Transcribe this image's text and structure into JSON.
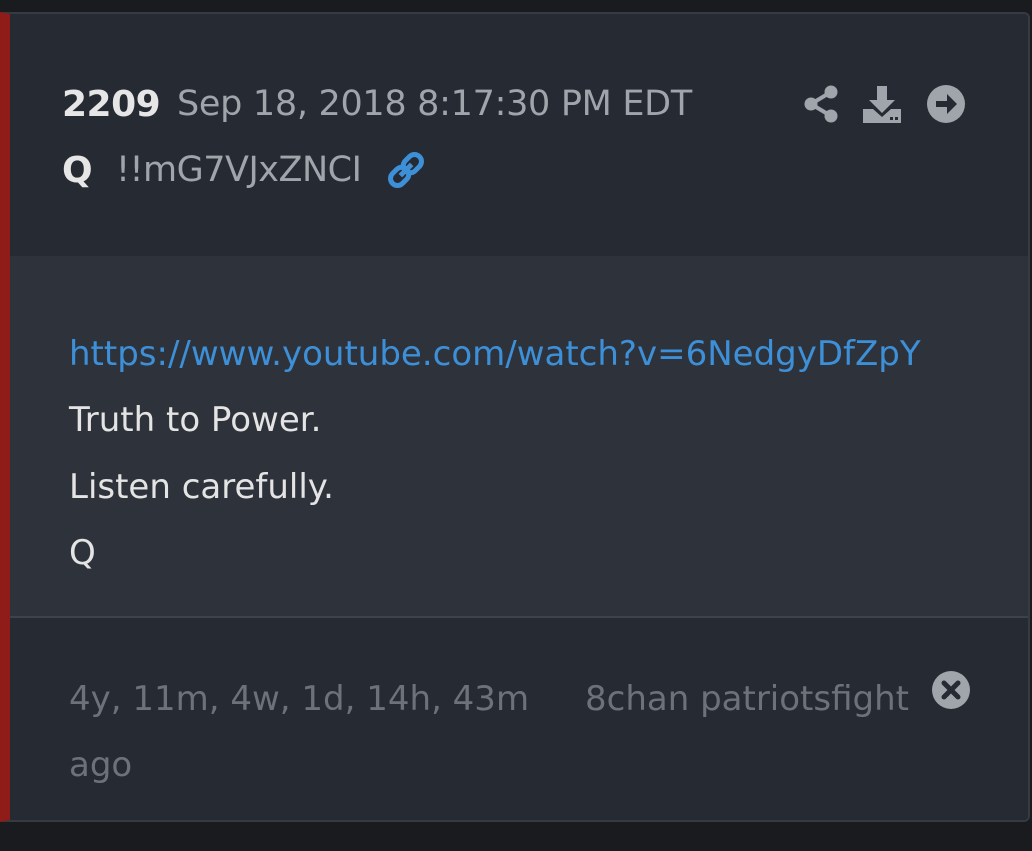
{
  "post": {
    "number": "2209",
    "timestamp": "Sep 18, 2018 8:17:30 PM EDT",
    "author": "Q",
    "tripcode": "!!mG7VJxZNCI"
  },
  "toolbar": {
    "icons": [
      "share-icon",
      "download-icon",
      "arrow-right-circle-icon"
    ],
    "link_icon": "link-icon"
  },
  "body": {
    "link": "https://www.youtube.com/watch?v=6NedgyDfZpY",
    "lines": [
      "Truth to Power.",
      "Listen carefully.",
      "Q"
    ]
  },
  "footer": {
    "age": "4y, 11m, 4w, 1d, 14h, 43m ago",
    "board": "8chan patriotsfight",
    "close_icon": "close-circle-icon"
  },
  "colors": {
    "accent_border": "#8f1c18",
    "link": "#3d8fd8",
    "card_bg": "#262a32",
    "body_bg": "#2e333b"
  }
}
